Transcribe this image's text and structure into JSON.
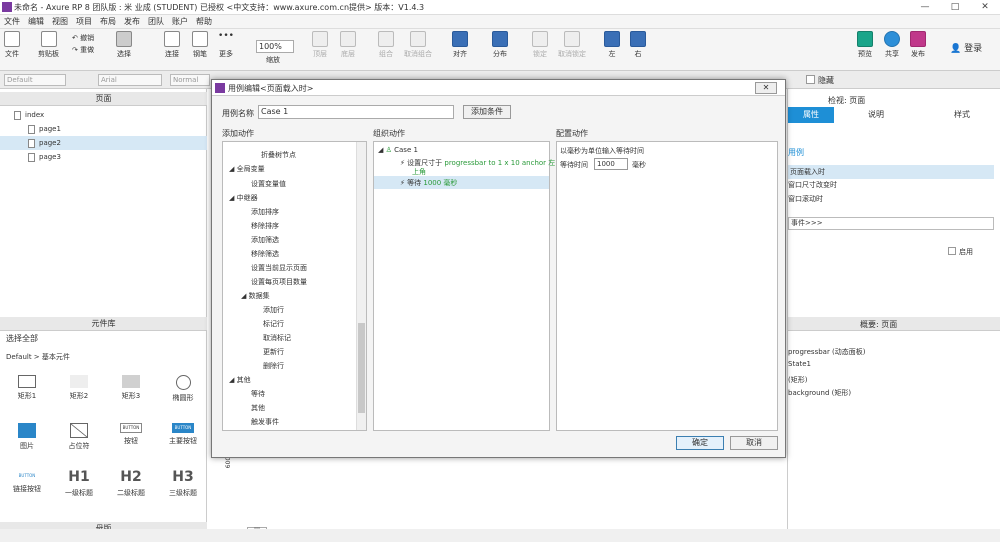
{
  "window": {
    "title": "未命名 - Axure RP 8 团队版 : 米 业成 (STUDENT) 已授权    <中文支持：www.axure.com.cn提供> 版本：V1.4.3",
    "min": "—",
    "max": "□",
    "close": "✕"
  },
  "menu": [
    "文件",
    "编辑",
    "视图",
    "项目",
    "布局",
    "发布",
    "团队",
    "账户",
    "帮助"
  ],
  "toolbar": {
    "file": "文件",
    "clipboard": "剪贴板",
    "undo": "撤销",
    "redo": "重做",
    "select": "选择",
    "connect": "连接",
    "pen": "钢笔",
    "more": "更多",
    "zoom": "100%",
    "zoom_label": "缩放",
    "top": "顶层",
    "bottom": "底层",
    "group": "组合",
    "ungroup": "取消组合",
    "align": "对齐",
    "distribute": "分布",
    "lock": "锁定",
    "unlock": "取消锁定",
    "left": "左",
    "right": "右",
    "preview": "预览",
    "share": "共享",
    "publish": "发布",
    "login": "登录"
  },
  "format": {
    "style": "Default",
    "font": "Arial",
    "weight": "Normal",
    "hide": "隐藏"
  },
  "pages_panel": {
    "title": "页面",
    "items": [
      {
        "label": "index",
        "indent": 0,
        "selected": false
      },
      {
        "label": "page1",
        "indent": 1,
        "selected": false
      },
      {
        "label": "page2",
        "indent": 1,
        "selected": true
      },
      {
        "label": "page3",
        "indent": 1,
        "selected": false
      }
    ]
  },
  "library_panel": {
    "title": "元件库",
    "select_all": "选择全部",
    "group": "Default > 基本元件",
    "widgets": [
      {
        "label": "矩形1"
      },
      {
        "label": "矩形2"
      },
      {
        "label": "矩形3"
      },
      {
        "label": "椭圆形"
      },
      {
        "label": "图片"
      },
      {
        "label": "占位符"
      },
      {
        "label": "按钮"
      },
      {
        "label": "主要按钮"
      },
      {
        "label": "链接按钮"
      },
      {
        "label": "一级标题"
      },
      {
        "label": "二级标题"
      },
      {
        "label": "三级标题"
      }
    ],
    "button_text": "BUTTON",
    "h1": "H1",
    "h2": "H2",
    "h3": "H3",
    "masters": "母版"
  },
  "right_panel": {
    "inspector": "检视: 页面",
    "tabs": [
      "属性",
      "说明",
      "样式"
    ],
    "case_link": "用例",
    "events": [
      "页面载入时",
      "窗口尺寸改变时",
      "窗口滚动时"
    ],
    "more_events": "事件>>>",
    "enable": "启用",
    "outline": "概要: 页面",
    "outline_items": [
      "progressbar (动态面板)",
      "State1",
      "(矩形)",
      "background (矩形)"
    ]
  },
  "canvas": {
    "ruler_mark": "600",
    "scroll_marker": "|||"
  },
  "dialog": {
    "title": "用例编辑<页面载入时>",
    "case_name_label": "用例名称",
    "case_name_value": "Case 1",
    "add_condition": "添加条件",
    "add_action": "添加动作",
    "organize_action": "组织动作",
    "config_action": "配置动作",
    "actions_tree": [
      {
        "label": "折叠树节点",
        "indent": 2
      },
      {
        "label": "全局变量",
        "indent": 0,
        "group": true
      },
      {
        "label": "设置变量值",
        "indent": 2
      },
      {
        "label": "中继器",
        "indent": 0,
        "group": true
      },
      {
        "label": "添加排序",
        "indent": 2
      },
      {
        "label": "移除排序",
        "indent": 2
      },
      {
        "label": "添加筛选",
        "indent": 2
      },
      {
        "label": "移除筛选",
        "indent": 2
      },
      {
        "label": "设置当前显示页面",
        "indent": 2
      },
      {
        "label": "设置每页项目数量",
        "indent": 2
      },
      {
        "label": "数据集",
        "indent": 1,
        "group": true
      },
      {
        "label": "添加行",
        "indent": 3
      },
      {
        "label": "标记行",
        "indent": 3
      },
      {
        "label": "取消标记",
        "indent": 3
      },
      {
        "label": "更新行",
        "indent": 3
      },
      {
        "label": "删除行",
        "indent": 3
      },
      {
        "label": "其他",
        "indent": 0,
        "group": true
      },
      {
        "label": "等待",
        "indent": 2
      },
      {
        "label": "其他",
        "indent": 2
      },
      {
        "label": "触发事件",
        "indent": 2
      }
    ],
    "case_node": "Case 1",
    "action1_prefix": "设置尺寸于",
    "action1_detail": "progressbar to 1 x 10 anchor 左",
    "action1_detail2": "上角",
    "action2_prefix": "等待",
    "action2_detail": "1000 毫秒",
    "config_desc": "以毫秒为单位输入等待时间",
    "wait_label": "等待时间",
    "wait_value": "1000",
    "wait_unit": "毫秒",
    "ok": "确定",
    "cancel": "取消"
  },
  "colors": {
    "accent": "#1e8fd6",
    "selection": "#d6e8f5",
    "action_text": "#2a9a3a",
    "purple": "#7a3aa0"
  }
}
